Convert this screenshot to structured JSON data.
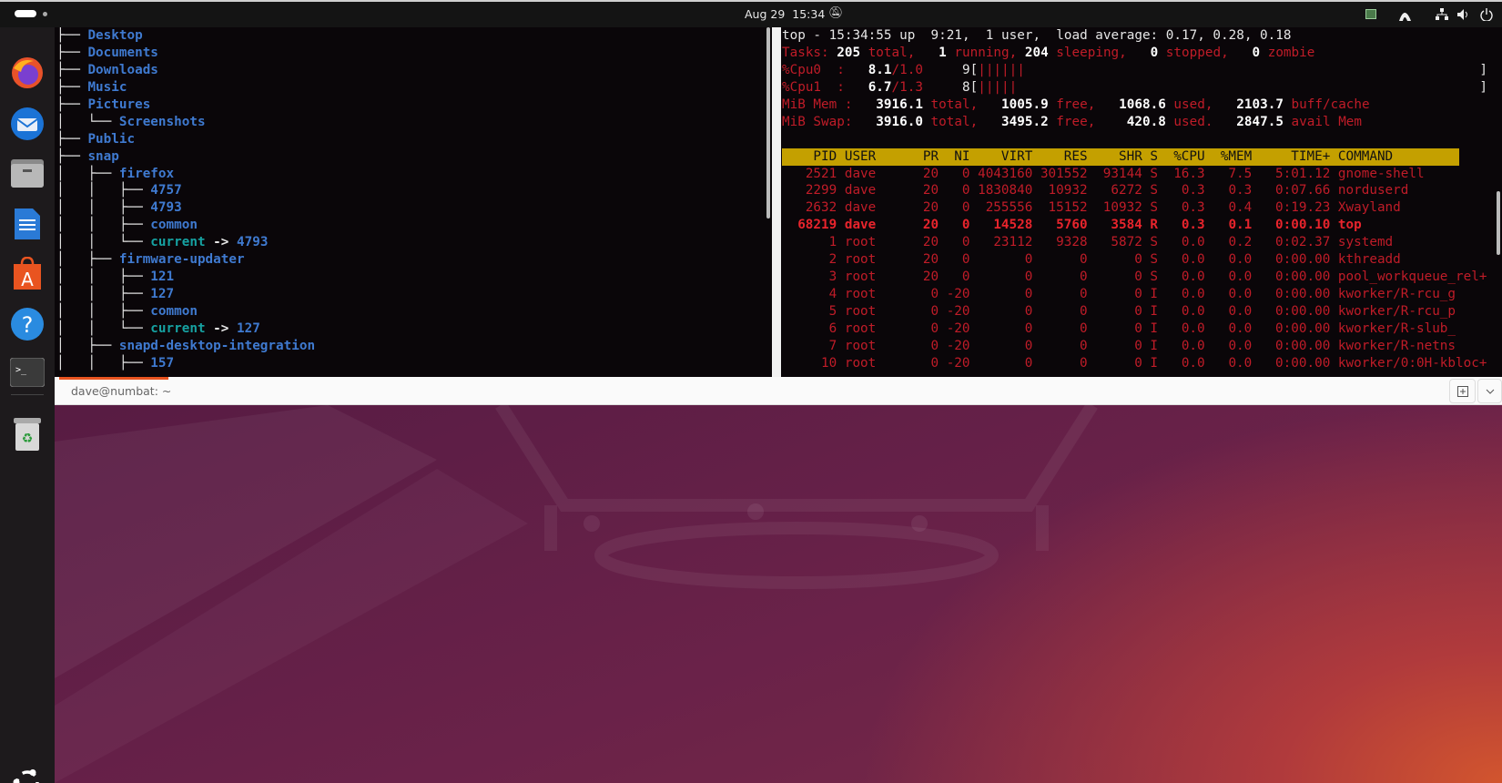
{
  "topbar": {
    "date": "Aug 29",
    "time": "15:34"
  },
  "dock": {
    "apps": [
      {
        "name": "firefox",
        "label": "Firefox"
      },
      {
        "name": "thunderbird",
        "label": "Thunderbird"
      },
      {
        "name": "files",
        "label": "Files"
      },
      {
        "name": "writer",
        "label": "LibreOffice Writer"
      },
      {
        "name": "app-center",
        "label": "App Center"
      },
      {
        "name": "help",
        "label": "Help"
      },
      {
        "name": "terminal",
        "label": "Terminal"
      },
      {
        "name": "trash",
        "label": "Trash"
      }
    ]
  },
  "terminal": {
    "title": "dave@numbat: ~"
  },
  "tree": [
    {
      "p": "├── ",
      "n": "Desktop"
    },
    {
      "p": "├── ",
      "n": "Documents"
    },
    {
      "p": "├── ",
      "n": "Downloads"
    },
    {
      "p": "├── ",
      "n": "Music"
    },
    {
      "p": "├── ",
      "n": "Pictures"
    },
    {
      "p": "│   └── ",
      "n": "Screenshots"
    },
    {
      "p": "├── ",
      "n": "Public"
    },
    {
      "p": "├── ",
      "n": "snap"
    },
    {
      "p": "│   ├── ",
      "n": "firefox"
    },
    {
      "p": "│   │   ├── ",
      "n": "4757"
    },
    {
      "p": "│   │   ├── ",
      "n": "4793"
    },
    {
      "p": "│   │   ├── ",
      "n": "common"
    },
    {
      "p": "│   │   └── ",
      "n": "current",
      "arrow": " -> ",
      "target": "4793"
    },
    {
      "p": "│   ├── ",
      "n": "firmware-updater"
    },
    {
      "p": "│   │   ├── ",
      "n": "121"
    },
    {
      "p": "│   │   ├── ",
      "n": "127"
    },
    {
      "p": "│   │   ├── ",
      "n": "common"
    },
    {
      "p": "│   │   └── ",
      "n": "current",
      "arrow": " -> ",
      "target": "127"
    },
    {
      "p": "│   ├── ",
      "n": "snapd-desktop-integration"
    },
    {
      "p": "│   │   ├── ",
      "n": "157"
    }
  ],
  "top": {
    "summary": [
      [
        {
          "t": "top - 15:34:55 up  9:21,  1 user,  load average: 0.17, 0.28, 0.18",
          "c": "w"
        }
      ],
      [
        {
          "t": "Tasks: ",
          "c": "r"
        },
        {
          "t": "205",
          "c": "W"
        },
        {
          "t": " total,   ",
          "c": "r"
        },
        {
          "t": "1",
          "c": "W"
        },
        {
          "t": " running, ",
          "c": "r"
        },
        {
          "t": "204",
          "c": "W"
        },
        {
          "t": " sleeping,   ",
          "c": "r"
        },
        {
          "t": "0",
          "c": "W"
        },
        {
          "t": " stopped,   ",
          "c": "r"
        },
        {
          "t": "0",
          "c": "W"
        },
        {
          "t": " zombie",
          "c": "r"
        }
      ],
      [
        {
          "t": "%Cpu0  :   ",
          "c": "r"
        },
        {
          "t": "8.1",
          "c": "W"
        },
        {
          "t": "/1.0",
          "c": "r"
        },
        {
          "t": "     9[",
          "c": "w"
        },
        {
          "t": "||||||",
          "c": "r"
        }
      ],
      [
        {
          "t": "%Cpu1  :   ",
          "c": "r"
        },
        {
          "t": "6.7",
          "c": "W"
        },
        {
          "t": "/1.3",
          "c": "r"
        },
        {
          "t": "     8[",
          "c": "w"
        },
        {
          "t": "|||||",
          "c": "r"
        }
      ],
      [
        {
          "t": "MiB Mem :   ",
          "c": "r"
        },
        {
          "t": "3916.1",
          "c": "W"
        },
        {
          "t": " total,   ",
          "c": "r"
        },
        {
          "t": "1005.9",
          "c": "W"
        },
        {
          "t": " free,   ",
          "c": "r"
        },
        {
          "t": "1068.6",
          "c": "W"
        },
        {
          "t": " used,   ",
          "c": "r"
        },
        {
          "t": "2103.7",
          "c": "W"
        },
        {
          "t": " buff/cache",
          "c": "r"
        }
      ],
      [
        {
          "t": "MiB Swap:   ",
          "c": "r"
        },
        {
          "t": "3916.0",
          "c": "W"
        },
        {
          "t": " total,   ",
          "c": "r"
        },
        {
          "t": "3495.2",
          "c": "W"
        },
        {
          "t": " free,    ",
          "c": "r"
        },
        {
          "t": "420.8",
          "c": "W"
        },
        {
          "t": " used.   ",
          "c": "r"
        },
        {
          "t": "2847.5",
          "c": "W"
        },
        {
          "t": " avail Mem",
          "c": "r"
        }
      ]
    ],
    "cpu_bracket": "]",
    "columns": [
      "PID",
      "USER",
      "PR",
      "NI",
      "VIRT",
      "RES",
      "SHR",
      "S",
      "%CPU",
      "%MEM",
      "TIME+",
      "COMMAND"
    ],
    "rows": [
      [
        "2521",
        "dave",
        "20",
        "0",
        "4043160",
        "301552",
        "93144",
        "S",
        "16.3",
        "7.5",
        "5:01.12",
        "gnome-shell"
      ],
      [
        "2299",
        "dave",
        "20",
        "0",
        "1830840",
        "10932",
        "6272",
        "S",
        "0.3",
        "0.3",
        "0:07.66",
        "norduserd"
      ],
      [
        "2632",
        "dave",
        "20",
        "0",
        "255556",
        "15152",
        "10932",
        "S",
        "0.3",
        "0.4",
        "0:19.23",
        "Xwayland"
      ],
      [
        "68219",
        "dave",
        "20",
        "0",
        "14528",
        "5760",
        "3584",
        "R",
        "0.3",
        "0.1",
        "0:00.10",
        "top"
      ],
      [
        "1",
        "root",
        "20",
        "0",
        "23112",
        "9328",
        "5872",
        "S",
        "0.0",
        "0.2",
        "0:02.37",
        "systemd"
      ],
      [
        "2",
        "root",
        "20",
        "0",
        "0",
        "0",
        "0",
        "S",
        "0.0",
        "0.0",
        "0:00.00",
        "kthreadd"
      ],
      [
        "3",
        "root",
        "20",
        "0",
        "0",
        "0",
        "0",
        "S",
        "0.0",
        "0.0",
        "0:00.00",
        "pool_workqueue_rel+"
      ],
      [
        "4",
        "root",
        "0",
        "-20",
        "0",
        "0",
        "0",
        "I",
        "0.0",
        "0.0",
        "0:00.00",
        "kworker/R-rcu_g"
      ],
      [
        "5",
        "root",
        "0",
        "-20",
        "0",
        "0",
        "0",
        "I",
        "0.0",
        "0.0",
        "0:00.00",
        "kworker/R-rcu_p"
      ],
      [
        "6",
        "root",
        "0",
        "-20",
        "0",
        "0",
        "0",
        "I",
        "0.0",
        "0.0",
        "0:00.00",
        "kworker/R-slub_"
      ],
      [
        "7",
        "root",
        "0",
        "-20",
        "0",
        "0",
        "0",
        "I",
        "0.0",
        "0.0",
        "0:00.00",
        "kworker/R-netns"
      ],
      [
        "10",
        "root",
        "0",
        "-20",
        "0",
        "0",
        "0",
        "I",
        "0.0",
        "0.0",
        "0:00.00",
        "kworker/0:0H-kbloc+"
      ]
    ],
    "highlight_row": 3
  }
}
